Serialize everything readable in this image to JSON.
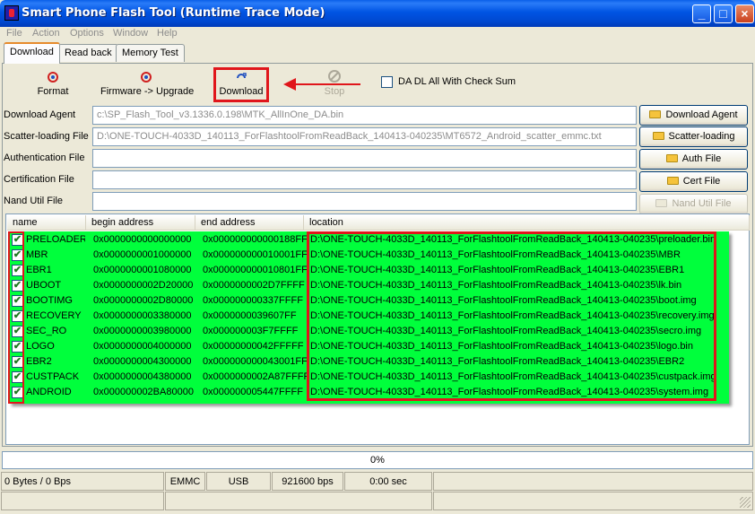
{
  "window": {
    "title": "Smart Phone Flash Tool (Runtime Trace Mode)"
  },
  "menu": [
    "File",
    "Action",
    "Options",
    "Window",
    "Help"
  ],
  "tabs": [
    "Download",
    "Read back",
    "Memory Test"
  ],
  "toolbar": {
    "format": "Format",
    "firmware_upgrade": "Firmware -> Upgrade",
    "download": "Download",
    "stop": "Stop",
    "checksum_label": "DA DL All With Check Sum"
  },
  "files": [
    {
      "label": "Download Agent",
      "value": "c:\\SP_Flash_Tool_v3.1336.0.198\\MTK_AllInOne_DA.bin",
      "button": "Download Agent"
    },
    {
      "label": "Scatter-loading File",
      "value": "D:\\ONE-TOUCH-4033D_140113_ForFlashtoolFromReadBack_140413-040235\\MT6572_Android_scatter_emmc.txt",
      "button": "Scatter-loading"
    },
    {
      "label": "Authentication File",
      "value": "",
      "button": "Auth File"
    },
    {
      "label": "Certification File",
      "value": "",
      "button": "Cert File"
    },
    {
      "label": "Nand Util File",
      "value": "",
      "button": "Nand Util File"
    }
  ],
  "columns": [
    "name",
    "begin address",
    "end address",
    "location"
  ],
  "partitions": [
    {
      "name": "PRELOADER",
      "begin": "0x0000000000000000",
      "end": "0x000000000000188FF",
      "location": "D:\\ONE-TOUCH-4033D_140113_ForFlashtoolFromReadBack_140413-040235\\preloader.bin"
    },
    {
      "name": "MBR",
      "begin": "0x0000000001000000",
      "end": "0x000000000010001FF",
      "location": "D:\\ONE-TOUCH-4033D_140113_ForFlashtoolFromReadBack_140413-040235\\MBR"
    },
    {
      "name": "EBR1",
      "begin": "0x0000000001080000",
      "end": "0x000000000010801FF",
      "location": "D:\\ONE-TOUCH-4033D_140113_ForFlashtoolFromReadBack_140413-040235\\EBR1"
    },
    {
      "name": "UBOOT",
      "begin": "0x0000000002D20000",
      "end": "0x0000000002D7FFFF",
      "location": "D:\\ONE-TOUCH-4033D_140113_ForFlashtoolFromReadBack_140413-040235\\lk.bin"
    },
    {
      "name": "BOOTIMG",
      "begin": "0x0000000002D80000",
      "end": "0x000000000337FFFF",
      "location": "D:\\ONE-TOUCH-4033D_140113_ForFlashtoolFromReadBack_140413-040235\\boot.img"
    },
    {
      "name": "RECOVERY",
      "begin": "0x0000000003380000",
      "end": "0x0000000039607FF",
      "location": "D:\\ONE-TOUCH-4033D_140113_ForFlashtoolFromReadBack_140413-040235\\recovery.img"
    },
    {
      "name": "SEC_RO",
      "begin": "0x0000000003980000",
      "end": "0x000000003F7FFFF",
      "location": "D:\\ONE-TOUCH-4033D_140113_ForFlashtoolFromReadBack_140413-040235\\secro.img"
    },
    {
      "name": "LOGO",
      "begin": "0x0000000004000000",
      "end": "0x00000000042FFFFF",
      "location": "D:\\ONE-TOUCH-4033D_140113_ForFlashtoolFromReadBack_140413-040235\\logo.bin"
    },
    {
      "name": "EBR2",
      "begin": "0x0000000004300000",
      "end": "0x000000000043001FF",
      "location": "D:\\ONE-TOUCH-4033D_140113_ForFlashtoolFromReadBack_140413-040235\\EBR2"
    },
    {
      "name": "CUSTPACK",
      "begin": "0x0000000004380000",
      "end": "0x0000000002A87FFFF",
      "location": "D:\\ONE-TOUCH-4033D_140113_ForFlashtoolFromReadBack_140413-040235\\custpack.img"
    },
    {
      "name": "ANDROID",
      "begin": "0x000000002BA80000",
      "end": "0x000000005447FFFF",
      "location": "D:\\ONE-TOUCH-4033D_140113_ForFlashtoolFromReadBack_140413-040235\\system.img"
    }
  ],
  "progress": {
    "text": "0%",
    "value": 0
  },
  "status": {
    "bytes": "0 Bytes / 0 Bps",
    "storage": "EMMC",
    "connection": "USB",
    "baud": "921600 bps",
    "time": "0:00 sec"
  },
  "colors": {
    "highlight_green": "#00ff3c",
    "annotation_red": "#e0161b",
    "title_blue": "#0054e3"
  }
}
